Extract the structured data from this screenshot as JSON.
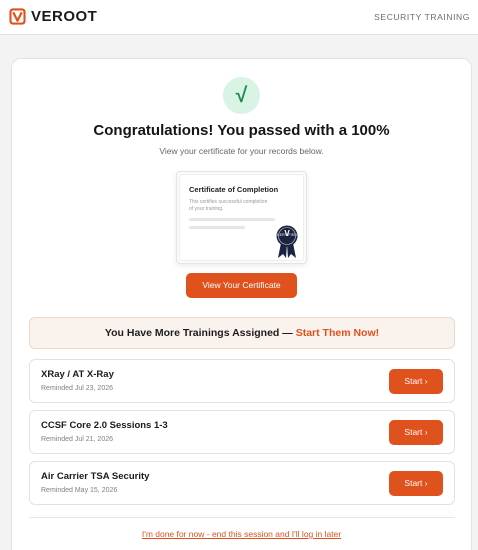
{
  "header": {
    "brand": "VEROOT",
    "section": "SECURITY TRAINING"
  },
  "result": {
    "check_symbol": "√",
    "headline": "Congratulations! You passed with a 100%",
    "subline": "View your certificate for your records below."
  },
  "certificate": {
    "title": "Certificate of Completion",
    "text": "This certifies successful completion of your training.",
    "seal_letter": "V",
    "seal_label": "CERTIFIED",
    "button_label": "View Your Certificate"
  },
  "banner": {
    "text": "You Have More Trainings Assigned — ",
    "accent": "Start Them Now!"
  },
  "trainings": [
    {
      "name": "XRay / AT X-Ray",
      "reminder": "Reminded Jul 23, 2026",
      "button": "Start ›"
    },
    {
      "name": "CCSF Core 2.0 Sessions 1-3",
      "reminder": "Reminded Jul 21, 2026",
      "button": "Start ›"
    },
    {
      "name": "Air Carrier TSA Security",
      "reminder": "Reminded May 15, 2026",
      "button": "Start ›"
    }
  ],
  "footer": {
    "end_session": "I'm done for now - end this session and I'll log in later"
  },
  "colors": {
    "accent": "#e0521d",
    "success_bg": "#d9f3e4",
    "success_fg": "#1c8a4e",
    "seal": "#1b2340"
  },
  "icons": {
    "logo": "veroot-logo-icon",
    "check": "check-icon",
    "seal": "certificate-seal-icon"
  }
}
